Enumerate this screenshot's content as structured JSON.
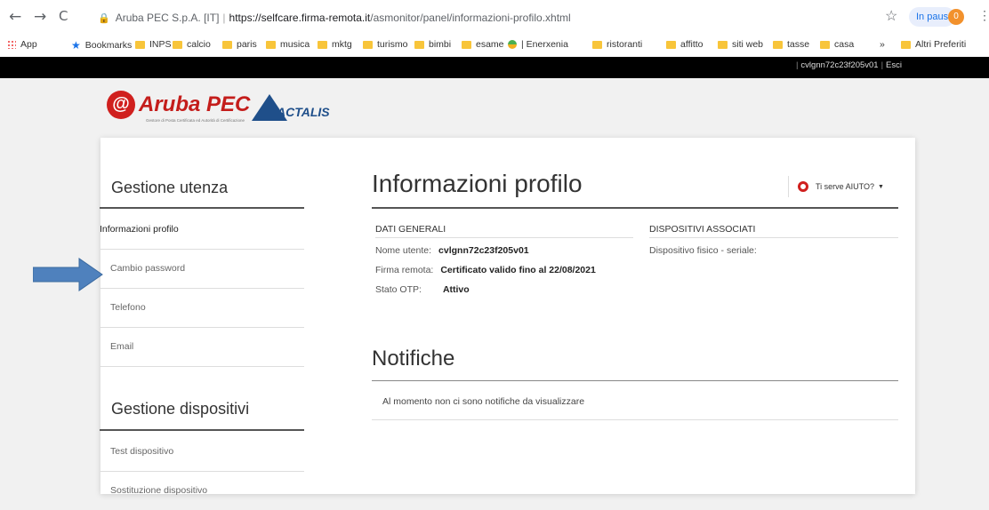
{
  "browser": {
    "back": "←",
    "forward": "→",
    "reload": "C",
    "site_label": "Aruba PEC S.p.A. [IT]",
    "url_host": "https://selfcare.firma-remota.it",
    "url_path": "/asmonitor/panel/informazioni-profilo.xhtml",
    "pause_label": "In pausa",
    "pause_badge": "0"
  },
  "bookmarks": [
    {
      "label": "App",
      "icon": "apps-icon"
    },
    {
      "label": "Bookmarks",
      "icon": "star-icon"
    },
    {
      "label": "INPS",
      "icon": "folder-icon"
    },
    {
      "label": "calcio",
      "icon": "folder-icon"
    },
    {
      "label": "paris",
      "icon": "folder-icon"
    },
    {
      "label": "musica",
      "icon": "folder-icon"
    },
    {
      "label": "mktg",
      "icon": "folder-icon"
    },
    {
      "label": "turismo",
      "icon": "folder-icon"
    },
    {
      "label": "bimbi",
      "icon": "folder-icon"
    },
    {
      "label": "esame",
      "icon": "folder-icon"
    },
    {
      "label": "| Enerxenia",
      "icon": "globe-icon"
    },
    {
      "label": "ristoranti",
      "icon": "folder-icon"
    },
    {
      "label": "affitto",
      "icon": "folder-icon"
    },
    {
      "label": "siti web",
      "icon": "folder-icon"
    },
    {
      "label": "tasse",
      "icon": "folder-icon"
    },
    {
      "label": "casa",
      "icon": "folder-icon"
    },
    {
      "label": "»",
      "icon": ""
    },
    {
      "label": "Altri Preferiti",
      "icon": "folder-icon"
    }
  ],
  "header": {
    "username": "cvlgnn72c23f205v01",
    "logout": "Esci"
  },
  "logos": {
    "aruba": "Aruba PEC",
    "aruba_mark": "@",
    "aruba_sub": "Gestore di Posta Certificata ed Autorità di Certificazione",
    "actalis": "ACTALIS"
  },
  "sidebar": {
    "section1_title": "Gestione utenza",
    "section1_items": [
      "Informazioni profilo",
      "Cambio password",
      "Telefono",
      "Email"
    ],
    "section2_title": "Gestione dispositivi",
    "section2_items": [
      "Test dispositivo",
      "Sostituzione dispositivo"
    ]
  },
  "main": {
    "title": "Informazioni profilo",
    "help_label": "Ti serve AIUTO?",
    "general_head": "DATI GENERALI",
    "devices_head": "DISPOSITIVI ASSOCIATI",
    "fields": [
      {
        "label": "Nome utente:",
        "value": "cvlgnn72c23f205v01"
      },
      {
        "label": "Firma remota:",
        "value": "Certificato valido fino al 22/08/2021"
      },
      {
        "label": "Stato OTP:",
        "value": "Attivo"
      }
    ],
    "device_field": "Dispositivo fisico - seriale:",
    "notifications_title": "Notifiche",
    "notifications_message": "Al momento non ci sono notifiche da visualizzare"
  },
  "colors": {
    "brand_red": "#c41d1b",
    "actalis_blue": "#1f4f8a",
    "arrow_blue": "#4f81bd"
  }
}
